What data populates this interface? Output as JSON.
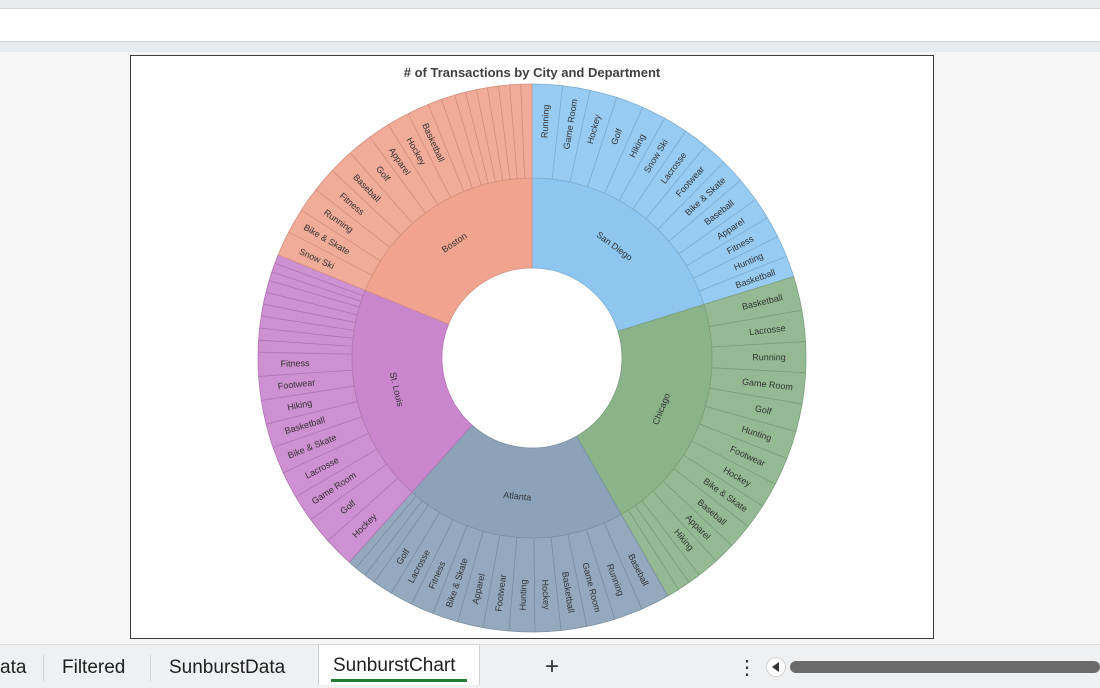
{
  "chart_data": {
    "type": "sunburst",
    "title": "# of Transactions by City and Department",
    "colors": {
      "San Diego": "#8ec6f0",
      "Chicago": "#8bb38a",
      "Atlanta": "#8ca2b8",
      "St. Louis": "#c986cc",
      "Boston": "#f0a490"
    },
    "cities": [
      {
        "name": "San Diego",
        "value": 120,
        "departments": [
          {
            "name": "Running",
            "value": 10
          },
          {
            "name": "Game Room",
            "value": 9
          },
          {
            "name": "Hockey",
            "value": 9
          },
          {
            "name": "Golf",
            "value": 9
          },
          {
            "name": "Hiking",
            "value": 8
          },
          {
            "name": "Snow Ski",
            "value": 8
          },
          {
            "name": "Lacrosse",
            "value": 8
          },
          {
            "name": "Footwear",
            "value": 8
          },
          {
            "name": "Bike & Skate",
            "value": 8
          },
          {
            "name": "Baseball",
            "value": 8
          },
          {
            "name": "Apparel",
            "value": 7
          },
          {
            "name": "Fitness",
            "value": 7
          },
          {
            "name": "Hunting",
            "value": 7
          },
          {
            "name": "Basketball",
            "value": 7
          }
        ]
      },
      {
        "name": "Chicago",
        "value": 128,
        "departments": [
          {
            "name": "Basketball",
            "value": 11
          },
          {
            "name": "Lacrosse",
            "value": 10
          },
          {
            "name": "Running",
            "value": 10
          },
          {
            "name": "Game Room",
            "value": 10
          },
          {
            "name": "Golf",
            "value": 9
          },
          {
            "name": "Hunting",
            "value": 9
          },
          {
            "name": "Footwear",
            "value": 9
          },
          {
            "name": "Hockey",
            "value": 8
          },
          {
            "name": "Bike & Skate",
            "value": 8
          },
          {
            "name": "Baseball",
            "value": 8
          },
          {
            "name": "Apparel",
            "value": 7
          },
          {
            "name": "Hiking",
            "value": 7
          },
          {
            "name": "",
            "value": 4
          },
          {
            "name": "",
            "value": 4
          },
          {
            "name": "",
            "value": 4
          }
        ]
      },
      {
        "name": "Atlanta",
        "value": 118,
        "departments": [
          {
            "name": "Baseball",
            "value": 10
          },
          {
            "name": "Running",
            "value": 10
          },
          {
            "name": "Game Room",
            "value": 10
          },
          {
            "name": "Basketball",
            "value": 9
          },
          {
            "name": "Hockey",
            "value": 9
          },
          {
            "name": "Hunting",
            "value": 9
          },
          {
            "name": "Footwear",
            "value": 9
          },
          {
            "name": "Apparel",
            "value": 9
          },
          {
            "name": "Bike & Skate",
            "value": 9
          },
          {
            "name": "Fitness",
            "value": 8
          },
          {
            "name": "Lacrosse",
            "value": 8
          },
          {
            "name": "Golf",
            "value": 7
          },
          {
            "name": "",
            "value": 4
          },
          {
            "name": "",
            "value": 4
          },
          {
            "name": "",
            "value": 3
          }
        ]
      },
      {
        "name": "St. Louis",
        "value": 116,
        "departments": [
          {
            "name": "Hockey",
            "value": 10
          },
          {
            "name": "Golf",
            "value": 9
          },
          {
            "name": "Game Room",
            "value": 9
          },
          {
            "name": "Lacrosse",
            "value": 9
          },
          {
            "name": "Bike & Skate",
            "value": 9
          },
          {
            "name": "Basketball",
            "value": 8
          },
          {
            "name": "Hiking",
            "value": 8
          },
          {
            "name": "Footwear",
            "value": 8
          },
          {
            "name": "Fitness",
            "value": 8
          },
          {
            "name": "",
            "value": 4
          },
          {
            "name": "",
            "value": 4
          },
          {
            "name": "",
            "value": 4
          },
          {
            "name": "",
            "value": 4
          },
          {
            "name": "",
            "value": 4
          },
          {
            "name": "",
            "value": 4
          },
          {
            "name": "",
            "value": 3
          },
          {
            "name": "",
            "value": 3
          },
          {
            "name": "",
            "value": 3
          }
        ]
      },
      {
        "name": "Boston",
        "value": 112,
        "departments": [
          {
            "name": "Snow Ski",
            "value": 9
          },
          {
            "name": "Bike & Skate",
            "value": 9
          },
          {
            "name": "Running",
            "value": 9
          },
          {
            "name": "Fitness",
            "value": 9
          },
          {
            "name": "Baseball",
            "value": 9
          },
          {
            "name": "Golf",
            "value": 9
          },
          {
            "name": "Apparel",
            "value": 8
          },
          {
            "name": "Hockey",
            "value": 8
          },
          {
            "name": "Basketball",
            "value": 8
          },
          {
            "name": "",
            "value": 5
          },
          {
            "name": "",
            "value": 5
          },
          {
            "name": "",
            "value": 4
          },
          {
            "name": "",
            "value": 4
          },
          {
            "name": "",
            "value": 4
          },
          {
            "name": "",
            "value": 4
          },
          {
            "name": "",
            "value": 4
          },
          {
            "name": "",
            "value": 4
          },
          {
            "name": "",
            "value": 4
          }
        ]
      }
    ]
  },
  "tabs": {
    "items": [
      "ata",
      "Filtered",
      "SunburstData"
    ],
    "active": "SunburstChart"
  }
}
